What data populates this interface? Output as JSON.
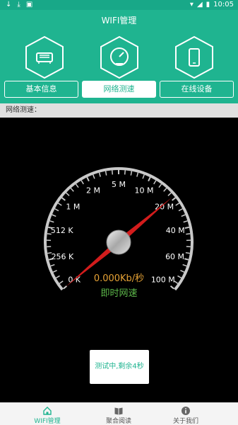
{
  "statusbar": {
    "time": "10:05"
  },
  "app": {
    "title": "WIFI管理"
  },
  "header": {
    "icons": [
      "router-icon",
      "speedometer-icon",
      "phone-icon"
    ]
  },
  "tabs": [
    {
      "label": "基本信息"
    },
    {
      "label": "网络测速"
    },
    {
      "label": "在线设备"
    }
  ],
  "section": {
    "label": "网络测速："
  },
  "gauge": {
    "ticks": [
      "0 K",
      "256 K",
      "512 K",
      "1 M",
      "2 M",
      "5 M",
      "10 M",
      "20 M",
      "40 M",
      "60 M",
      "100 M"
    ],
    "speed_text": "0.000Kb/秒",
    "speed_label": "即时网速",
    "needle_value": "0 K",
    "colors": {
      "needle": "#d21c1c",
      "speed": "#e6a235",
      "label": "#5db84a"
    }
  },
  "test_status": "测试中,剩余4秒",
  "bottom_nav": [
    {
      "label": "WIFI管理",
      "icon": "home-icon"
    },
    {
      "label": "聚合阅读",
      "icon": "book-icon"
    },
    {
      "label": "关于我们",
      "icon": "info-icon"
    }
  ],
  "colors": {
    "primary": "#1fb490",
    "statusbar": "#18a888"
  }
}
